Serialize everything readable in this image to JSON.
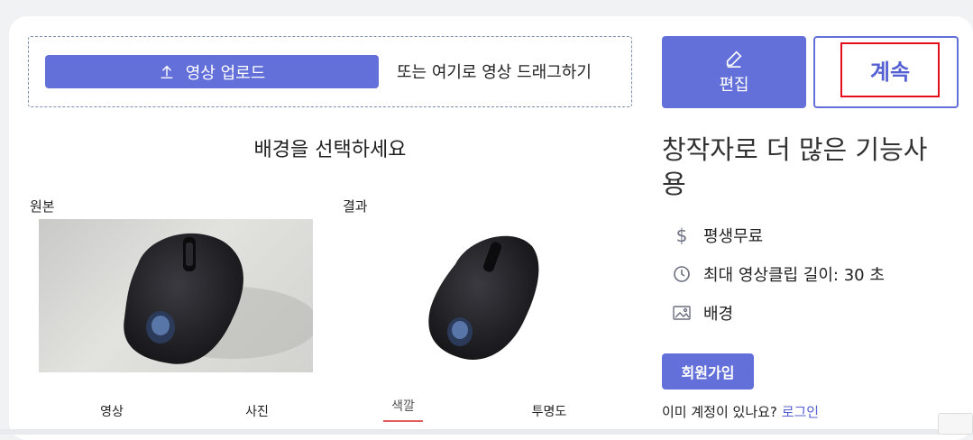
{
  "upload": {
    "button_label": "영상 업로드",
    "drag_text": "또는 여기로 영상 드래그하기",
    "icon": "upload-icon"
  },
  "actions": {
    "edit_label": "편집",
    "edit_icon": "pencil-icon",
    "continue_label": "계속"
  },
  "background": {
    "title": "배경을 선택하세요",
    "original_label": "원본",
    "result_label": "결과"
  },
  "tabs": [
    {
      "label": "영상"
    },
    {
      "label": "사진"
    },
    {
      "label": "색깔",
      "active": true
    },
    {
      "label": "투명도"
    }
  ],
  "promo": {
    "title": "창작자로 더 많은 기능사용",
    "features": [
      {
        "icon": "dollar-icon",
        "text": "평생무료"
      },
      {
        "icon": "clock-icon",
        "text": "최대 영상클립 길이: 30 초"
      },
      {
        "icon": "image-icon",
        "text": "배경"
      }
    ],
    "signup_label": "회원가입",
    "login_prompt": "이미 계정이 있나요?",
    "login_link": "로그인"
  },
  "colors": {
    "accent": "#6370d9",
    "highlight_border": "#e3101b",
    "tab_underline": "#e35a5a"
  }
}
